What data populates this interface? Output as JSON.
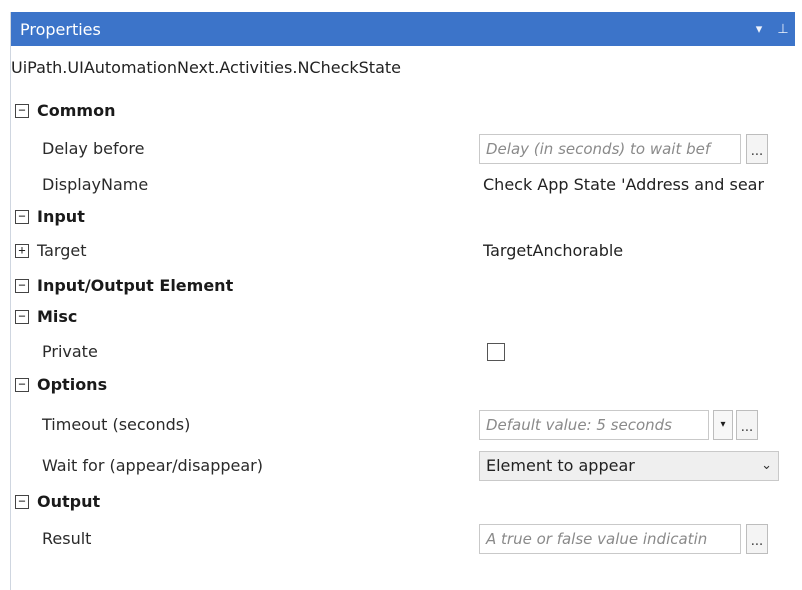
{
  "panel": {
    "title": "Properties",
    "icons": {
      "dropdown": "▾",
      "pin": "⊥"
    },
    "activity": "UiPath.UIAutomationNext.Activities.NCheckState"
  },
  "categories": {
    "common": "Common",
    "input": "Input",
    "io_element": "Input/Output Element",
    "misc": "Misc",
    "options": "Options",
    "output": "Output"
  },
  "props": {
    "delay_before": {
      "label": "Delay before",
      "placeholder": "Delay (in seconds) to wait bef"
    },
    "display_name": {
      "label": "DisplayName",
      "value": "Check App State 'Address and sear"
    },
    "target": {
      "label": "Target",
      "value": "TargetAnchorable"
    },
    "private": {
      "label": "Private"
    },
    "timeout": {
      "label": "Timeout (seconds)",
      "placeholder": "Default value: 5 seconds"
    },
    "wait_for": {
      "label": "Wait for (appear/disappear)",
      "value": "Element to appear"
    },
    "result": {
      "label": "Result",
      "placeholder": "A true or false value indicatin"
    }
  },
  "glyphs": {
    "collapse": "−",
    "expand": "+",
    "ellipsis": "...",
    "chevron": "⌄",
    "spin_down": "▾"
  }
}
